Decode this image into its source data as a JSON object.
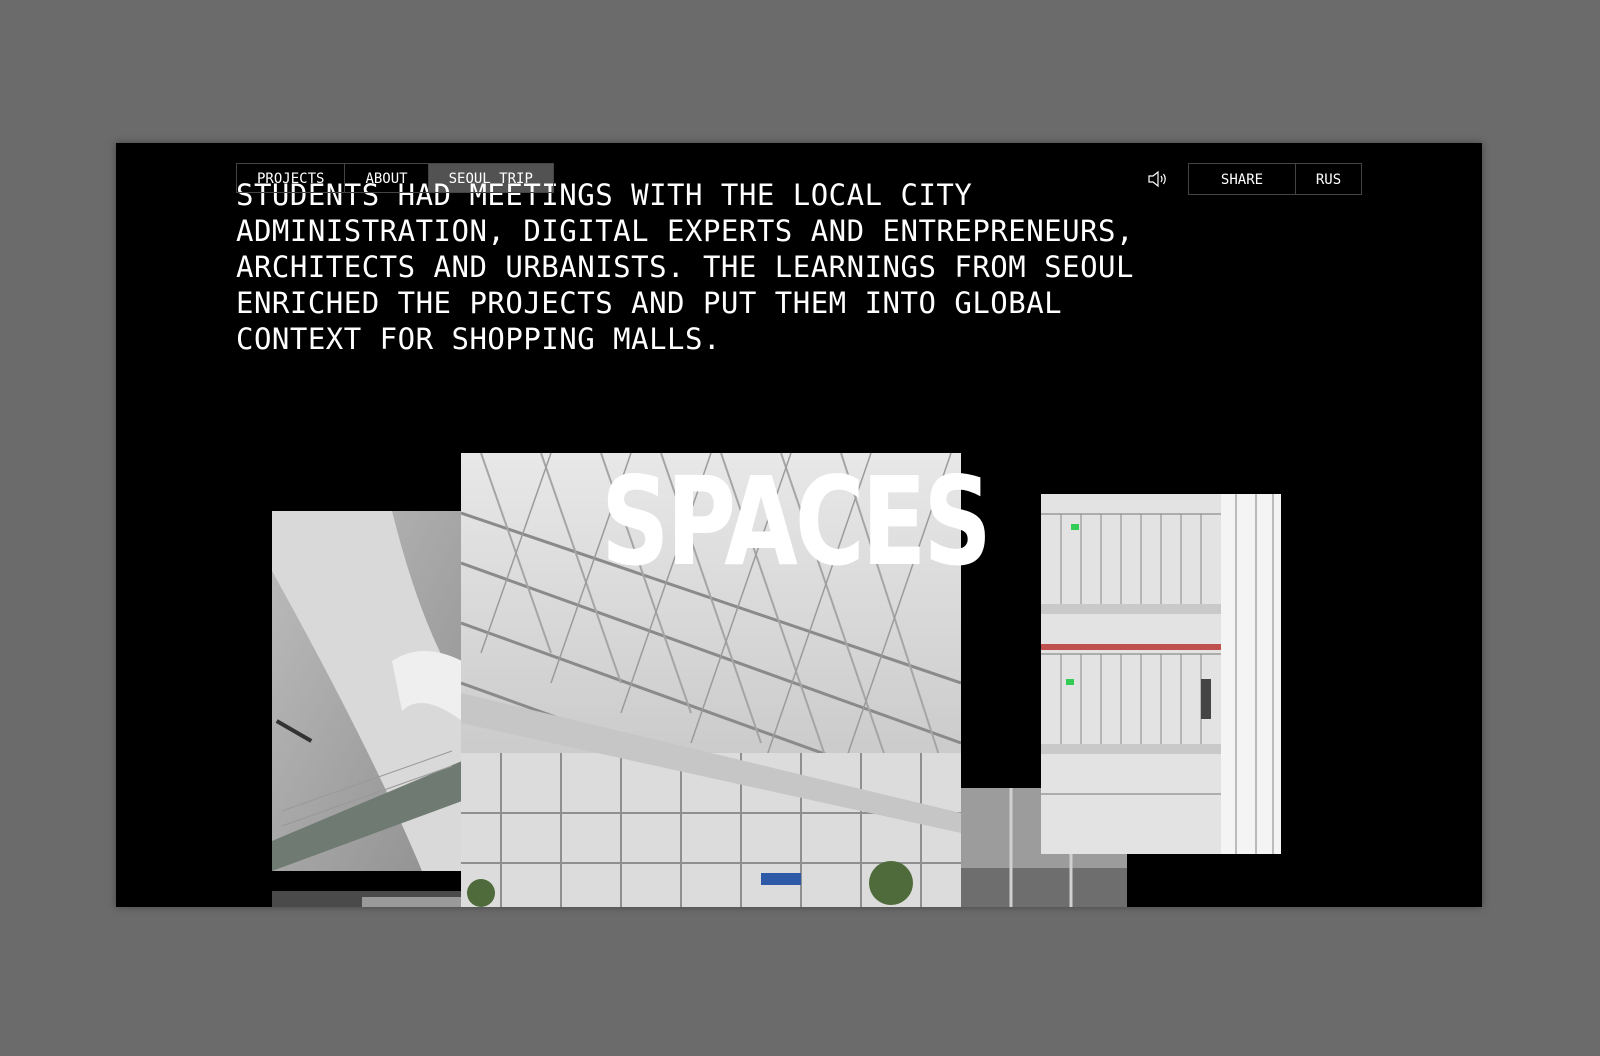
{
  "nav": {
    "items": [
      {
        "label": "PROJECTS"
      },
      {
        "label": "ABOUT"
      },
      {
        "label": "SEOUL TRIP"
      }
    ],
    "active": "SEOUL TRIP"
  },
  "header_right": {
    "sound_icon": "speaker-icon",
    "share_label": "SHARE",
    "lang_label": "RUS"
  },
  "intro": {
    "text": "STUDENTS HAD MEETINGS WITH THE LOCAL CITY ADMINISTRATION, DIGITAL EXPERTS AND ENTREPRENEURS, ARCHITECTS AND URBANISTS. THE LEARNINGS FROM SEOUL ENRICHED THE PROJECTS AND PUT THEM INTO GLOBAL CONTEXT FOR SHOPPING MALLS."
  },
  "section": {
    "title": "SPACES"
  },
  "colors": {
    "background": "#6b6b6b",
    "frame": "#000000",
    "text": "#ffffff",
    "accent_green": "#33cc55"
  }
}
